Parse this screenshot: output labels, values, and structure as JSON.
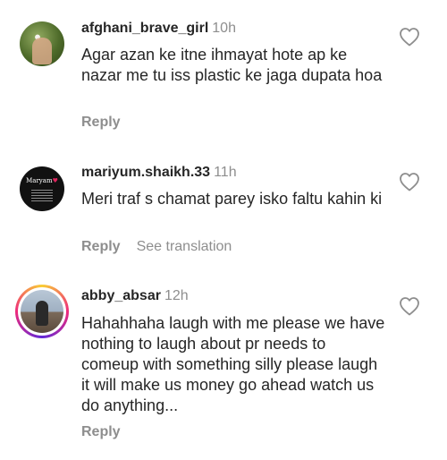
{
  "comments": [
    {
      "username": "afghani_brave_girl",
      "time": "10h",
      "text": "Agar azan ke itne ihmayat hote ap ke nazar me tu iss plastic ke jaga dupata hoa",
      "reply_label": "Reply"
    },
    {
      "username": "mariyum.shaikh.33",
      "time": "11h",
      "avatar_text": "Maryam",
      "text": "Meri traf s chamat parey isko faltu kahin ki",
      "reply_label": "Reply",
      "translate_label": "See translation"
    },
    {
      "username": "abby_absar",
      "time": "12h",
      "text": "Hahahhaha laugh with me please we have nothing to laugh about pr needs to comeup with something silly please laugh it will make us money go ahead watch us do anything...",
      "reply_label": "Reply"
    }
  ],
  "icons": {
    "like": "heart-outline-icon"
  },
  "colors": {
    "text": "#262626",
    "secondary": "#8e8e8e",
    "background": "#ffffff"
  }
}
